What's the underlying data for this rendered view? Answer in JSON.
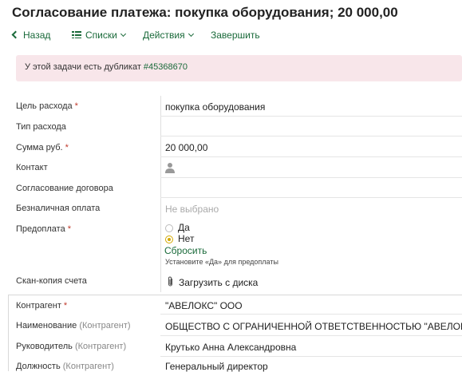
{
  "title": "Согласование платежа: покупка оборудования; 20 000,00",
  "toolbar": {
    "back": "Назад",
    "lists": "Списки",
    "actions": "Действия",
    "finish": "Завершить"
  },
  "alert": {
    "text": "У этой задачи есть дубликат",
    "link": "#45368670"
  },
  "fields": {
    "purpose_label": "Цель расхода",
    "purpose_value": "покупка оборудования",
    "expense_type_label": "Тип расхода",
    "amount_label": "Сумма руб.",
    "amount_value": "20 000,00",
    "contact_label": "Контакт",
    "contract_label": "Согласование договора",
    "cashless_label": "Безналичная оплата",
    "cashless_value": "Не выбрано",
    "prepay_label": "Предоплата",
    "prepay_yes": "Да",
    "prepay_no": "Нет",
    "prepay_reset": "Сбросить",
    "prepay_hint": "Установите «Да» для предоплаты",
    "scan_label": "Скан-копия счета",
    "scan_upload": "Загрузить с диска",
    "required_mark": "*"
  },
  "counterparty": {
    "label": "Контрагент",
    "value": "\"АВЕЛОКС\" ООО",
    "name_label": "Наименование",
    "name_suffix": "(Контрагент)",
    "name_value": "ОБЩЕСТВО С ОГРАНИЧЕННОЙ ОТВЕТСТВЕННОСТЬЮ \"АВЕЛОКС\"",
    "head_label": "Руководитель",
    "head_suffix": "(Контрагент)",
    "head_value": "Крутько Анна Александровна",
    "position_label": "Должность",
    "position_suffix": "(Контрагент)",
    "position_value": "Генеральный директор"
  },
  "colors": {
    "accent": "#1a6a3a",
    "alert_bg": "#f8e6ea",
    "required": "#c0392b",
    "radio_checked": "#d4a900"
  },
  "prepay_selected": "Нет"
}
